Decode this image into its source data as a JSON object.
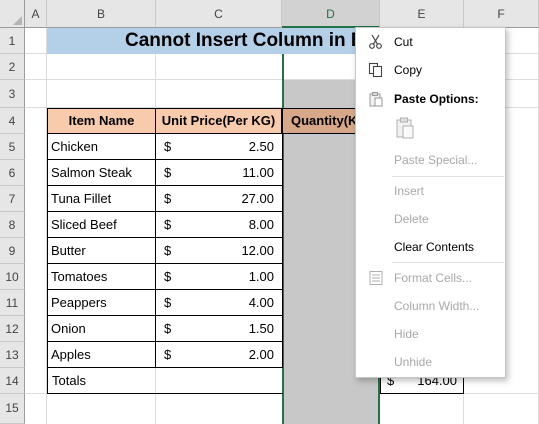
{
  "columns": [
    "A",
    "B",
    "C",
    "D",
    "E",
    "F"
  ],
  "rows": [
    "1",
    "2",
    "3",
    "4",
    "5",
    "6",
    "7",
    "8",
    "9",
    "10",
    "11",
    "12",
    "13",
    "14",
    "15"
  ],
  "title": "Cannot Insert Column in Ex",
  "table": {
    "headers": [
      "Item Name",
      "Unit Price(Per KG)",
      "Quantity(K"
    ],
    "items": [
      {
        "name": "Chicken",
        "currency": "$",
        "price": "2.50"
      },
      {
        "name": "Salmon Steak",
        "currency": "$",
        "price": "11.00"
      },
      {
        "name": "Tuna Fillet",
        "currency": "$",
        "price": "27.00"
      },
      {
        "name": "Sliced Beef",
        "currency": "$",
        "price": "8.00"
      },
      {
        "name": "Butter",
        "currency": "$",
        "price": "12.00"
      },
      {
        "name": "Tomatoes",
        "currency": "$",
        "price": "1.00"
      },
      {
        "name": "Peappers",
        "currency": "$",
        "price": "4.00"
      },
      {
        "name": "Onion",
        "currency": "$",
        "price": "1.50"
      },
      {
        "name": "Apples",
        "currency": "$",
        "price": "2.00"
      }
    ],
    "totals_label": "Totals",
    "totals_currency": "$",
    "totals_value": "164.00"
  },
  "context_menu": {
    "cut": "Cut",
    "copy": "Copy",
    "paste_options": "Paste Options:",
    "paste_special": "Paste Special...",
    "insert": "Insert",
    "delete": "Delete",
    "clear_contents": "Clear Contents",
    "format_cells": "Format Cells...",
    "column_width": "Column Width...",
    "hide": "Hide",
    "unhide": "Unhide"
  },
  "colors": {
    "selection": "#217346",
    "header_fill": "#f8cbad",
    "title_fill": "#b4cfe8",
    "selected_column_fill": "#c8c8c8"
  }
}
